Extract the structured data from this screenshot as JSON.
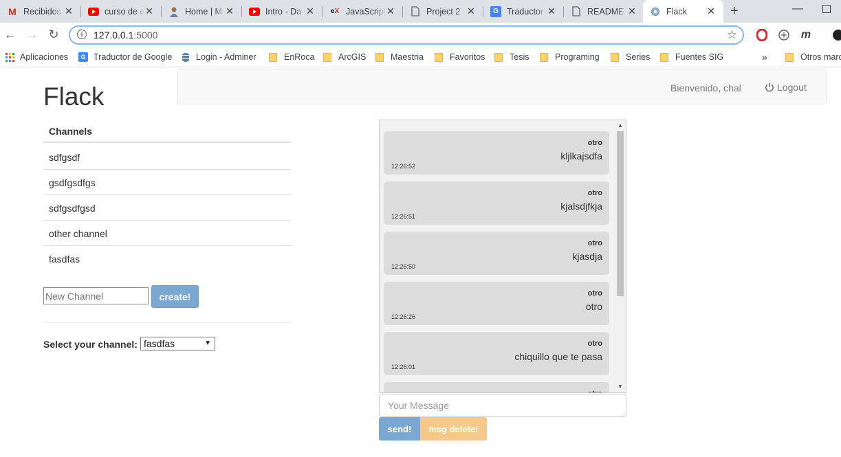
{
  "browser": {
    "tabs": [
      {
        "title": "Recibidos",
        "icon": "gmail-icon"
      },
      {
        "title": "curso de e",
        "icon": "youtube-icon"
      },
      {
        "title": "Home | M",
        "icon": "person-icon"
      },
      {
        "title": "Intro - Da",
        "icon": "youtube-icon"
      },
      {
        "title": "JavaScript",
        "icon": "edx-icon"
      },
      {
        "title": "Project 2",
        "icon": "document-icon"
      },
      {
        "title": "Traductor",
        "icon": "google-translate-icon"
      },
      {
        "title": "README",
        "icon": "document-icon"
      },
      {
        "title": "Flack",
        "icon": "globe-icon",
        "active": true
      }
    ],
    "url_host": "127.0.0.1",
    "url_port": ":5000",
    "bookmarks": [
      {
        "label": "Aplicaciones",
        "icon": "apps-icon"
      },
      {
        "label": "Traductor de Google",
        "icon": "google-translate-icon"
      },
      {
        "label": "Login - Adminer",
        "icon": "database-icon"
      },
      {
        "label": "EnRoca",
        "icon": "folder-icon"
      },
      {
        "label": "ArcGIS",
        "icon": "folder-icon"
      },
      {
        "label": "Maestria",
        "icon": "folder-icon"
      },
      {
        "label": "Favoritos",
        "icon": "folder-icon"
      },
      {
        "label": "Tesis",
        "icon": "folder-icon"
      },
      {
        "label": "Programing",
        "icon": "folder-icon"
      },
      {
        "label": "Series",
        "icon": "folder-icon"
      },
      {
        "label": "Fuentes SIG",
        "icon": "folder-icon"
      },
      {
        "label": "Otros marc",
        "icon": "folder-icon"
      }
    ],
    "bookmarks_more": "»"
  },
  "app": {
    "brand": "Flack",
    "welcome": "Bienvenido, chal",
    "logout": "Logout"
  },
  "sidebar": {
    "heading": "Channels",
    "channels": [
      "sdfgsdf",
      "gsdfgsdfgs",
      "sdfgsdfgsd",
      "other channel",
      "fasdfas"
    ],
    "new_channel_placeholder": "New Channel",
    "create_label": "create!",
    "select_label": "Select your channel:",
    "selected_channel": "fasdfas"
  },
  "chat": {
    "messages": [
      {
        "user": "otro",
        "text": "kljlkajsdfa",
        "time": "12:26:52"
      },
      {
        "user": "otro",
        "text": "kjalsdjfkja",
        "time": "12:26:51"
      },
      {
        "user": "otro",
        "text": "kjasdja",
        "time": "12:26:50"
      },
      {
        "user": "otro",
        "text": "otro",
        "time": "12:26:26"
      },
      {
        "user": "otro",
        "text": "chiquillo que te pasa",
        "time": "12:26:01"
      },
      {
        "user": "otro",
        "text": "",
        "time": ""
      }
    ],
    "message_placeholder": "Your Message",
    "send_label": "send!",
    "delete_label": "msg delete!"
  }
}
